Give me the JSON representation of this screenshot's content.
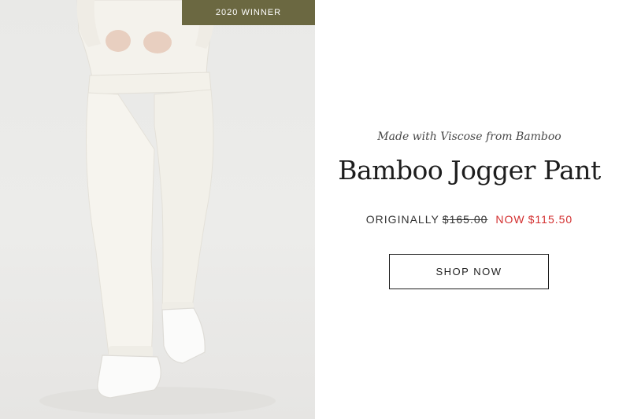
{
  "badge": {
    "label": "2020 WINNER"
  },
  "product": {
    "tagline": "Made with Viscose from Bamboo",
    "title": "Bamboo Jogger Pant",
    "original_label": "ORIGINALLY",
    "original_price": "$165.00",
    "now_label": "NOW",
    "now_price": "$115.50"
  },
  "cta": {
    "label": "SHOP NOW"
  },
  "colors": {
    "badge_bg": "#6b6841",
    "sale_red": "#d32f2f",
    "text_dark": "#1d1d1d"
  }
}
